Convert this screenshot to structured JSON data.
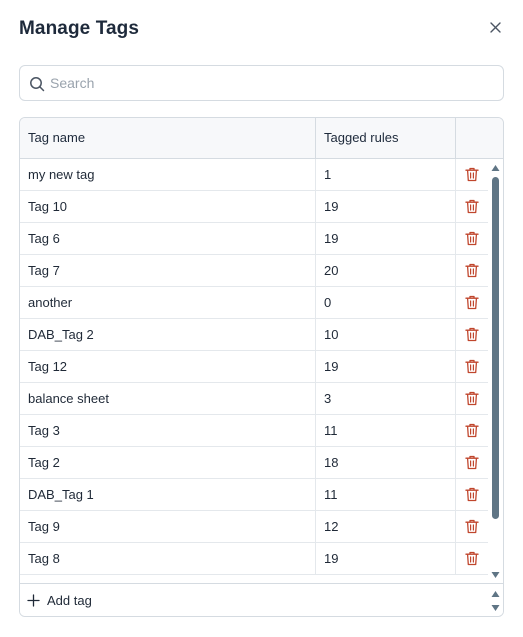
{
  "dialog": {
    "title": "Manage Tags",
    "close_icon": "close-icon"
  },
  "search": {
    "placeholder": "Search",
    "value": "",
    "icon": "search-icon"
  },
  "table": {
    "columns": [
      "Tag name",
      "Tagged rules",
      ""
    ],
    "rows": [
      {
        "name": "my new tag",
        "count": "1"
      },
      {
        "name": "Tag 10",
        "count": "19"
      },
      {
        "name": "Tag 6",
        "count": "19"
      },
      {
        "name": "Tag 7",
        "count": "20"
      },
      {
        "name": "another",
        "count": "0"
      },
      {
        "name": "DAB_Tag 2",
        "count": "10"
      },
      {
        "name": "Tag 12",
        "count": "19"
      },
      {
        "name": "balance sheet",
        "count": "3"
      },
      {
        "name": "Tag 3",
        "count": "11"
      },
      {
        "name": "Tag 2",
        "count": "18"
      },
      {
        "name": "DAB_Tag 1",
        "count": "11"
      },
      {
        "name": "Tag 9",
        "count": "12"
      },
      {
        "name": "Tag 8",
        "count": "19"
      }
    ],
    "row_action_icon": "trash-icon"
  },
  "footer": {
    "add_label": "Add tag",
    "add_icon": "plus-icon"
  },
  "colors": {
    "title": "#1e2a3b",
    "border": "#d5dbe1",
    "trash": "#c0462d",
    "scroll_thumb": "#5f7585"
  }
}
